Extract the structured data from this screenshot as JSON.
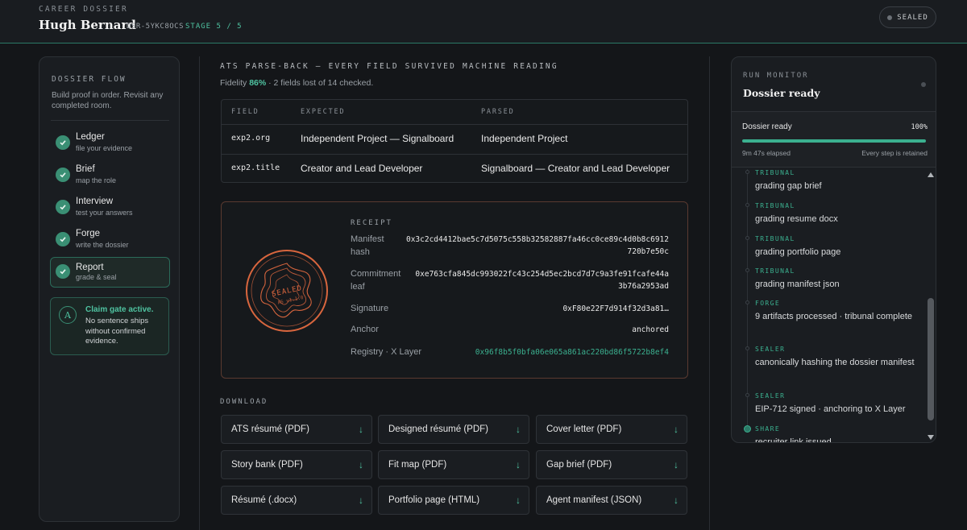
{
  "header": {
    "kicker": "CAREER DOSSIER",
    "name": "Hugh Bernard",
    "dossier_id": "DSR-5YKC8OCS",
    "stage": "STAGE 5 / 5",
    "status_pill": "SEALED"
  },
  "sidebar": {
    "title": "DOSSIER FLOW",
    "description": "Build proof in order. Revisit any completed room.",
    "steps": [
      {
        "name": "Ledger",
        "sub": "file your evidence"
      },
      {
        "name": "Brief",
        "sub": "map the role"
      },
      {
        "name": "Interview",
        "sub": "test your answers"
      },
      {
        "name": "Forge",
        "sub": "write the dossier"
      },
      {
        "name": "Report",
        "sub": "grade & seal"
      }
    ],
    "active_step": "Report",
    "claim": {
      "icon": "A",
      "title": "Claim gate active.",
      "text": "No sentence ships without confirmed evidence."
    }
  },
  "ats": {
    "title": "ATS PARSE-BACK — EVERY FIELD SURVIVED MACHINE READING",
    "fidelity_label": "Fidelity",
    "fidelity_pct": "86%",
    "fidelity_rest": "· 2 fields lost of 14 checked.",
    "columns": [
      "FIELD",
      "EXPECTED",
      "PARSED"
    ],
    "rows": [
      {
        "field": "exp2.org",
        "expected": "Independent Project — Signalboard",
        "parsed": "Independent Project"
      },
      {
        "field": "exp2.title",
        "expected": "Creator and Lead Developer",
        "parsed": "Signalboard — Creator and Lead Developer"
      }
    ]
  },
  "receipt": {
    "title": "RECEIPT",
    "seal_text": "SEALED",
    "seal_version": "AS v1.1.0",
    "rows": [
      {
        "label": "Manifest hash",
        "value": "0x3c2cd4412bae5c7d5075c558b32582887fa46cc0ce89c4d0b8c6912 720b7e50c"
      },
      {
        "label": "Commitment leaf",
        "value": "0xe763cfa845dc993022fc43c254d5ec2bcd7d7c9a3fe91fcafe44a 3b76a2953ad"
      },
      {
        "label": "Signature",
        "value": "0xF80e22F7d914f32d3a81…"
      },
      {
        "label": "Anchor",
        "value": "anchored"
      },
      {
        "label": "Registry · X Layer",
        "value": "0x96f8b5f0bfa06e065a861ac220bd86f5722b8ef4"
      }
    ]
  },
  "downloads": {
    "title": "DOWNLOAD",
    "items": [
      "ATS résumé (PDF)",
      "Designed résumé (PDF)",
      "Cover letter (PDF)",
      "Story bank (PDF)",
      "Fit map (PDF)",
      "Gap brief (PDF)",
      "Résumé (.docx)",
      "Portfolio page (HTML)",
      "Agent manifest (JSON)"
    ],
    "arrow": "↓"
  },
  "monitor": {
    "kicker": "RUN MONITOR",
    "title": "Dossier ready",
    "status": "Dossier ready",
    "progress_pct": "100%",
    "progress": 1.0,
    "elapsed": "9m 47s elapsed",
    "retained": "Every step is retained",
    "events": [
      {
        "tag": "TRIBUNAL",
        "text": "grading gap brief"
      },
      {
        "tag": "TRIBUNAL",
        "text": "grading resume docx"
      },
      {
        "tag": "TRIBUNAL",
        "text": "grading portfolio page"
      },
      {
        "tag": "TRIBUNAL",
        "text": "grading manifest json"
      },
      {
        "tag": "FORGE",
        "text": "9 artifacts processed · tribunal complete"
      },
      {
        "tag": "SEALER",
        "text": "canonically hashing the dossier manifest"
      },
      {
        "tag": "SEALER",
        "text": "EIP-712 signed · anchoring to X Layer"
      },
      {
        "tag": "SHARE",
        "text": "recruiter link issued"
      }
    ]
  },
  "colors": {
    "accent": "#4fc3a1",
    "receipt_border": "#5a3a30",
    "seal": "#d9663e"
  }
}
